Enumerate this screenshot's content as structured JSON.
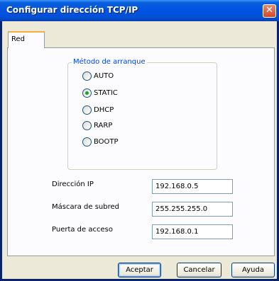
{
  "window": {
    "title": "Configurar dirección TCP/IP",
    "close_symbol": "✕"
  },
  "tabs": [
    {
      "label": "Red",
      "selected": true
    }
  ],
  "boot_method": {
    "legend": "Método de arranque",
    "options": [
      {
        "label": "AUTO",
        "checked": false
      },
      {
        "label": "STATIC",
        "checked": true
      },
      {
        "label": "DHCP",
        "checked": false
      },
      {
        "label": "RARP",
        "checked": false
      },
      {
        "label": "BOOTP",
        "checked": false
      }
    ]
  },
  "fields": {
    "ip_label": "Dirección IP",
    "ip_value": "192.168.0.5",
    "mask_label": "Máscara de subred",
    "mask_value": "255.255.255.0",
    "gateway_label": "Puerta de acceso",
    "gateway_value": "192.168.0.1"
  },
  "buttons": {
    "ok": "Aceptar",
    "cancel": "Cancelar",
    "help": "Ayuda"
  }
}
